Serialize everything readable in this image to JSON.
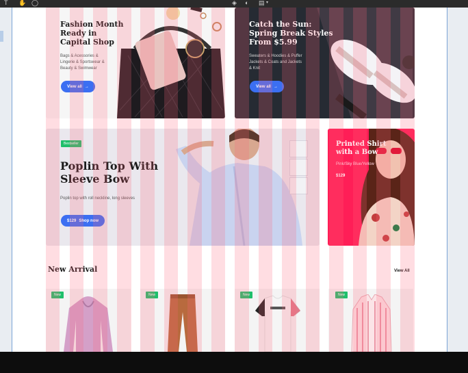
{
  "toolbar": {
    "icons": [
      "type-tool-icon",
      "hand-tool-icon",
      "comment-icon",
      "component-icon",
      "contrast-icon",
      "layers-icon"
    ]
  },
  "hero": {
    "fashion": {
      "title": "Fashion Month Ready in Capital Shop",
      "subtitle": "Bags & Acessories & Lingerie & Sportswear & Beauty & Swimwear",
      "button": "View all"
    },
    "sun": {
      "title": "Catch the Sun: Spring Break Styles From $5.99",
      "subtitle": "Sweaters & Hoodies & Puffer Jackets & Coats and Jackets & Knit",
      "button": "View all"
    },
    "poplin": {
      "badge": "Bestseller",
      "title": "Poplin Top With Sleeve Bow",
      "subtitle": "Poplin top with roll neckline, long sleeves",
      "price": "$129",
      "button": "Shop now"
    },
    "shirt": {
      "title": "Printed Shirt with a Bow",
      "subtitle": "Pink/Sky Blue/Yellow",
      "price": "$129"
    }
  },
  "new_arrival": {
    "title": "New Arrival",
    "view_all": "View All",
    "products": [
      {
        "badge": "New",
        "kind": "hoodie"
      },
      {
        "badge": "New",
        "kind": "trousers"
      },
      {
        "badge": "New",
        "kind": "tshirt"
      },
      {
        "badge": "New",
        "kind": "striped-shirt"
      }
    ]
  },
  "colors": {
    "accent": "#3b6ff2",
    "badge_green": "#1fbf6b",
    "promo_pink": "#ff1e57",
    "grid_overlay": "#ff647d"
  }
}
